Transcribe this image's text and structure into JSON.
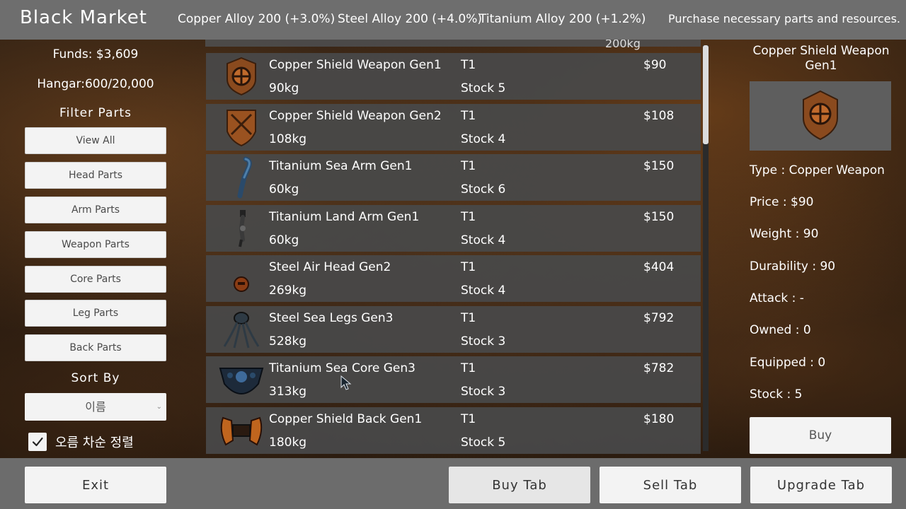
{
  "header": {
    "title": "Black Market",
    "tickers": [
      "Copper Alloy 200 (+3.0%)",
      "Steel Alloy 200 (+4.0%)",
      "Titanium Alloy 200 (+1.2%)"
    ],
    "tagline": "Purchase necessary parts and resources."
  },
  "sidebar": {
    "funds": "Funds: $3,609",
    "hangar": "Hangar:600/20,000",
    "filter_title": "Filter Parts",
    "filters": [
      "View All",
      "Head Parts",
      "Arm Parts",
      "Weapon Parts",
      "Core Parts",
      "Leg Parts",
      "Back Parts"
    ],
    "sort_title": "Sort By",
    "sort_value": "이름",
    "descending_label": "오름 차순 정렬",
    "descending_checked": true
  },
  "list": {
    "peek_weight": "200kg",
    "items": [
      {
        "name": "Copper Shield Weapon Gen1",
        "weight": "90kg",
        "tier": "T1",
        "stock": "Stock 5",
        "price": "$90",
        "icon": "copper-shield-weapon-icon"
      },
      {
        "name": "Copper Shield Weapon Gen2",
        "weight": "108kg",
        "tier": "T1",
        "stock": "Stock 4",
        "price": "$108",
        "icon": "copper-shield-weapon-icon"
      },
      {
        "name": "Titanium Sea Arm Gen1",
        "weight": "60kg",
        "tier": "T1",
        "stock": "Stock 6",
        "price": "$150",
        "icon": "titanium-arm-icon"
      },
      {
        "name": "Titanium Land Arm Gen1",
        "weight": "60kg",
        "tier": "T1",
        "stock": "Stock 4",
        "price": "$150",
        "icon": "titanium-arm-icon"
      },
      {
        "name": "Steel Air Head Gen2",
        "weight": "269kg",
        "tier": "T1",
        "stock": "Stock 4",
        "price": "$404",
        "icon": "steel-head-icon"
      },
      {
        "name": "Steel Sea Legs Gen3",
        "weight": "528kg",
        "tier": "T1",
        "stock": "Stock 3",
        "price": "$792",
        "icon": "steel-legs-icon"
      },
      {
        "name": "Titanium Sea Core Gen3",
        "weight": "313kg",
        "tier": "T1",
        "stock": "Stock 3",
        "price": "$782",
        "icon": "titanium-core-icon"
      },
      {
        "name": "Copper Shield Back Gen1",
        "weight": "180kg",
        "tier": "T1",
        "stock": "Stock 5",
        "price": "$180",
        "icon": "copper-back-icon"
      }
    ]
  },
  "detail": {
    "name": "Copper Shield Weapon Gen1",
    "type": "Type : Copper Weapon",
    "price": "Price : $90",
    "weight": "Weight : 90",
    "durability": "Durability : 90",
    "attack": "Attack : -",
    "owned": "Owned : 0",
    "equipped": "Equipped : 0",
    "stock": "Stock : 5",
    "buy_label": "Buy",
    "icon": "copper-shield-weapon-icon"
  },
  "footer": {
    "exit": "Exit",
    "buy_tab": "Buy Tab",
    "sell_tab": "Sell Tab",
    "upgrade_tab": "Upgrade Tab"
  },
  "colors": {
    "bar": "#6e6e6e",
    "row": "#484848",
    "button": "#f3f3f3",
    "copper": "#b5652a"
  }
}
